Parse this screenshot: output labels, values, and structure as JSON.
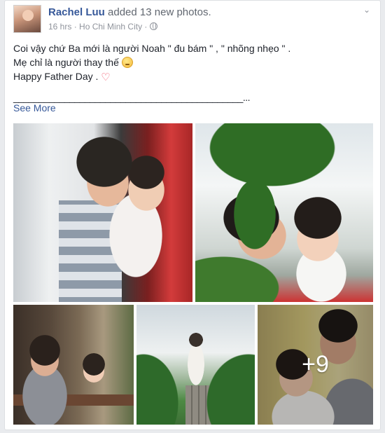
{
  "post": {
    "author": "Rachel Luu",
    "action": "added 13 new photos.",
    "time": "16 hrs",
    "separator": "·",
    "location": "Ho Chi Minh City",
    "privacy_icon": "globe-icon",
    "menu_icon": "chevron-down-icon",
    "lines": [
      "Coi vậy chứ Ba mới là người Noah \" đu bám \" , \" nhõng nhẹo \" .",
      "Mẹ chỉ là người thay thế",
      "Happy Father Day ."
    ],
    "line2_emoji": "worried-face-emoji",
    "line3_emoji": "heart-icon",
    "heart_char": "♡",
    "divider": "_____________________________________________...",
    "see_more": "See More"
  },
  "photos": {
    "count": 5,
    "more_label": "+9"
  },
  "colors": {
    "link": "#365899",
    "meta": "#90949c",
    "heart": "#f25268"
  }
}
